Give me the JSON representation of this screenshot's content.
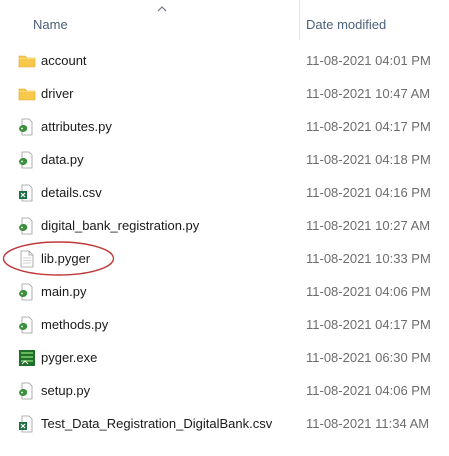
{
  "header": {
    "name_label": "Name",
    "date_label": "Date modified"
  },
  "files": [
    {
      "name": "account",
      "date": "11-08-2021 04:01 PM",
      "icon": "folder-icon"
    },
    {
      "name": "driver",
      "date": "11-08-2021 10:47 AM",
      "icon": "folder-icon"
    },
    {
      "name": "attributes.py",
      "date": "11-08-2021 04:17 PM",
      "icon": "python-file-icon"
    },
    {
      "name": "data.py",
      "date": "11-08-2021 04:18 PM",
      "icon": "python-file-icon"
    },
    {
      "name": "details.csv",
      "date": "11-08-2021 04:16 PM",
      "icon": "excel-csv-icon"
    },
    {
      "name": "digital_bank_registration.py",
      "date": "11-08-2021 10:27 AM",
      "icon": "python-file-icon"
    },
    {
      "name": "lib.pyger",
      "date": "11-08-2021 10:33 PM",
      "icon": "generic-file-icon"
    },
    {
      "name": "main.py",
      "date": "11-08-2021 04:06 PM",
      "icon": "python-file-icon"
    },
    {
      "name": "methods.py",
      "date": "11-08-2021 04:17 PM",
      "icon": "python-file-icon"
    },
    {
      "name": "pyger.exe",
      "date": "11-08-2021 06:30 PM",
      "icon": "pyger-exe-icon"
    },
    {
      "name": "setup.py",
      "date": "11-08-2021 04:06 PM",
      "icon": "python-file-icon"
    },
    {
      "name": "Test_Data_Registration_DigitalBank.csv",
      "date": "11-08-2021 11:34 AM",
      "icon": "excel-csv-icon"
    }
  ],
  "colors": {
    "folder": "#f8c84a",
    "highlight_oval": "#c0393b",
    "header_text": "#4c607a",
    "date_text": "#6d6d6d",
    "excel_green": "#1d7044",
    "python_green": "#3c8f3c"
  }
}
